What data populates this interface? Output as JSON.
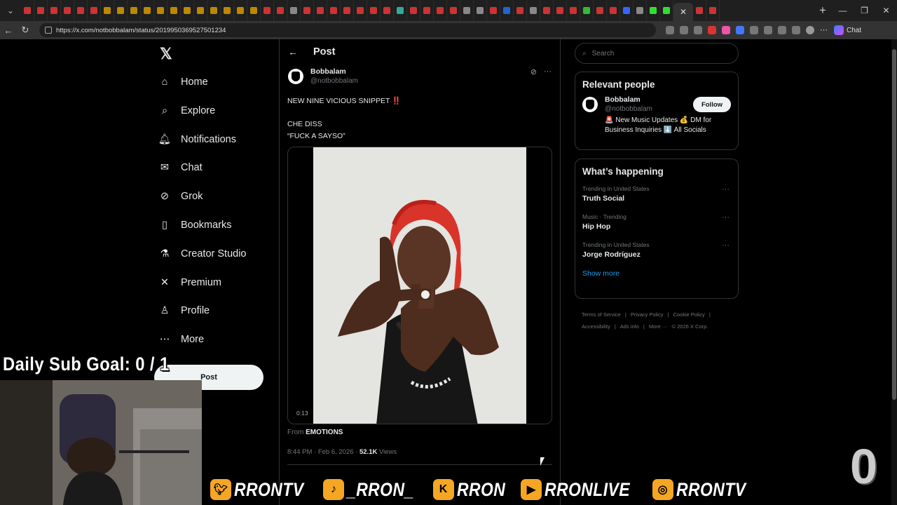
{
  "browser": {
    "url": "https://x.com/notbobbalam/status/2019950369527501234",
    "tab_count_visible": 56,
    "chat_label": "Chat"
  },
  "sidebar": {
    "logo": "𝕏",
    "items": [
      {
        "label": "Home",
        "icon": "home-icon"
      },
      {
        "label": "Explore",
        "icon": "search-icon"
      },
      {
        "label": "Notifications",
        "icon": "bell-icon"
      },
      {
        "label": "Chat",
        "icon": "mail-icon"
      },
      {
        "label": "Grok",
        "icon": "grok-icon"
      },
      {
        "label": "Bookmarks",
        "icon": "bookmark-icon"
      },
      {
        "label": "Creator Studio",
        "icon": "flask-icon"
      },
      {
        "label": "Premium",
        "icon": "x-icon"
      },
      {
        "label": "Profile",
        "icon": "person-icon"
      },
      {
        "label": "More",
        "icon": "more-circle-icon"
      }
    ],
    "post_button": "Post"
  },
  "main": {
    "header_title": "Post",
    "author_name": "Bobbalam",
    "author_handle": "@notbobbalam",
    "text": "NEW NINE VICIOUS SNIPPET ‼️\n\nCHE DISS\n“FUCK A SAYSO”",
    "video_time": "0:13",
    "from_prefix": "From",
    "from_name": "EMOTIONS",
    "timestamp": "8:44 PM · Feb 6, 2026 · ",
    "views_count": "52.1K",
    "views_label": "Views"
  },
  "right": {
    "search_placeholder": "Search",
    "relevant_title": "Relevant people",
    "rp_name": "Bobbalam",
    "rp_handle": "@notbobbalam",
    "rp_bio": "🚨 New Music Updates 💰 DM for Business Inquiries ⬇️ All Socials",
    "follow_label": "Follow",
    "happening_title": "What’s happening",
    "trends": [
      {
        "category": "Trending in United States",
        "name": "Truth Social"
      },
      {
        "category": "Music · Trending",
        "name": "Hip Hop"
      },
      {
        "category": "Trending in United States",
        "name": "Jorge Rodríguez"
      }
    ],
    "show_more": "Show more",
    "footer": [
      "Terms of Service",
      "|",
      "Privacy Policy",
      "|",
      "Cookie Policy",
      "|",
      "Accessibility",
      "|",
      "Ads info",
      "|",
      "More ···",
      "© 2026 X Corp."
    ]
  },
  "overlay": {
    "goal_text": "Daily Sub Goal:  0 / 1",
    "socials": [
      {
        "icon": "twitter-icon",
        "handle": "RRONTV",
        "color": "#f5a623"
      },
      {
        "icon": "tiktok-icon",
        "handle": "_RRON_",
        "color": "#f5a623"
      },
      {
        "icon": "kick-icon",
        "handle": "RRON",
        "color": "#f5a623"
      },
      {
        "icon": "youtube-icon",
        "handle": "RRONLIVE",
        "color": "#f5a623"
      },
      {
        "icon": "instagram-icon",
        "handle": "RRONTV",
        "color": "#f5a623"
      }
    ],
    "badge": "0"
  },
  "colors": {
    "accent": "#1d9bf0",
    "background": "#000000",
    "border": "#2f3336",
    "muted": "#71767b"
  }
}
